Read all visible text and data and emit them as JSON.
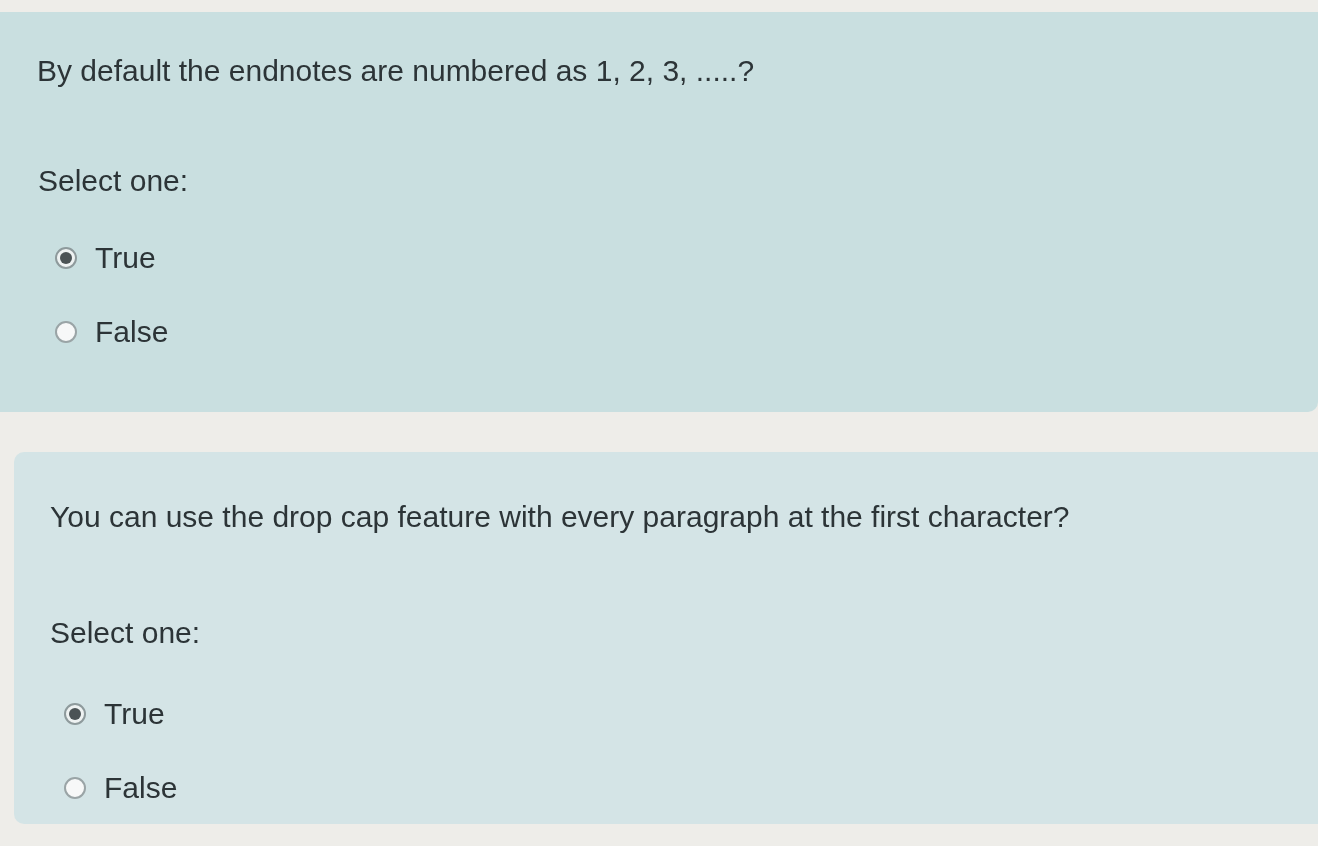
{
  "questions": [
    {
      "text": "By default the endnotes are numbered as 1, 2, 3, .....?",
      "prompt": "Select one:",
      "options": [
        {
          "label": "True",
          "selected": true
        },
        {
          "label": "False",
          "selected": false
        }
      ]
    },
    {
      "text": "You can use the drop cap feature with every paragraph at the first character?",
      "prompt": "Select one:",
      "options": [
        {
          "label": "True",
          "selected": true
        },
        {
          "label": "False",
          "selected": false
        }
      ]
    }
  ]
}
